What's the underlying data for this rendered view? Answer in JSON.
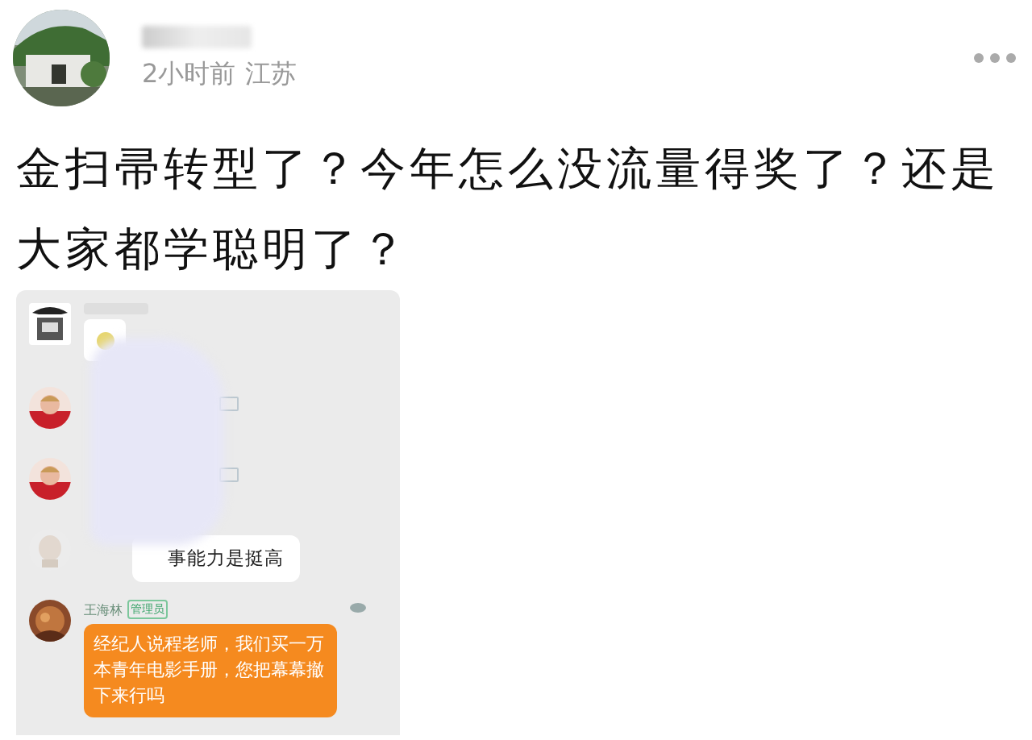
{
  "post": {
    "time": "2小时前",
    "location": "江苏",
    "text": "金扫帚转型了？今年怎么没流量得奖了？还是大家都学聪明了？"
  },
  "chat": {
    "messages": [
      {
        "kind": "sticker"
      },
      {
        "kind": "covered"
      },
      {
        "kind": "covered"
      },
      {
        "kind": "text",
        "text": "事能力是挺高"
      },
      {
        "kind": "highlight",
        "sender": "王海林",
        "badge": "管理员",
        "text": "经纪人说程老师，我们买一万本青年电影手册，您把幕幕撤下来行吗"
      }
    ]
  }
}
